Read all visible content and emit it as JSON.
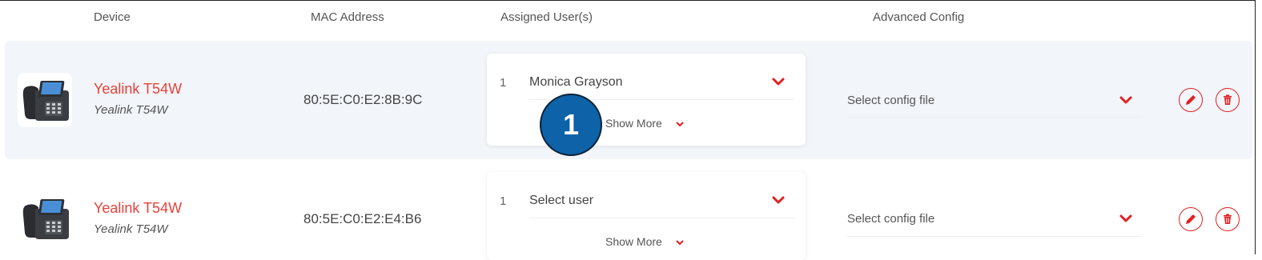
{
  "header": {
    "device": "Device",
    "mac": "MAC Address",
    "users": "Assigned User(s)",
    "config": "Advanced Config"
  },
  "rows": [
    {
      "device_name": "Yealink T54W",
      "device_model": "Yealink T54W",
      "mac": "80:5E:C0:E2:8B:9C",
      "user_index": "1",
      "user": "Monica Grayson",
      "show_more": "Show More",
      "config": "Select config file"
    },
    {
      "device_name": "Yealink T54W",
      "device_model": "Yealink T54W",
      "mac": "80:5E:C0:E2:E4:B6",
      "user_index": "1",
      "user": "Select user",
      "show_more": "Show More",
      "config": "Select config file"
    }
  ],
  "badge": {
    "label": "1"
  },
  "icons": {
    "phone": "desk-phone-icon",
    "chevron": "chevron-down-icon",
    "edit": "pencil-icon",
    "delete": "trash-icon"
  },
  "colors": {
    "accent": "#e02222",
    "device_name": "#e8413a",
    "row_highlight": "#f2f5f9",
    "badge": "#0d62a8"
  }
}
